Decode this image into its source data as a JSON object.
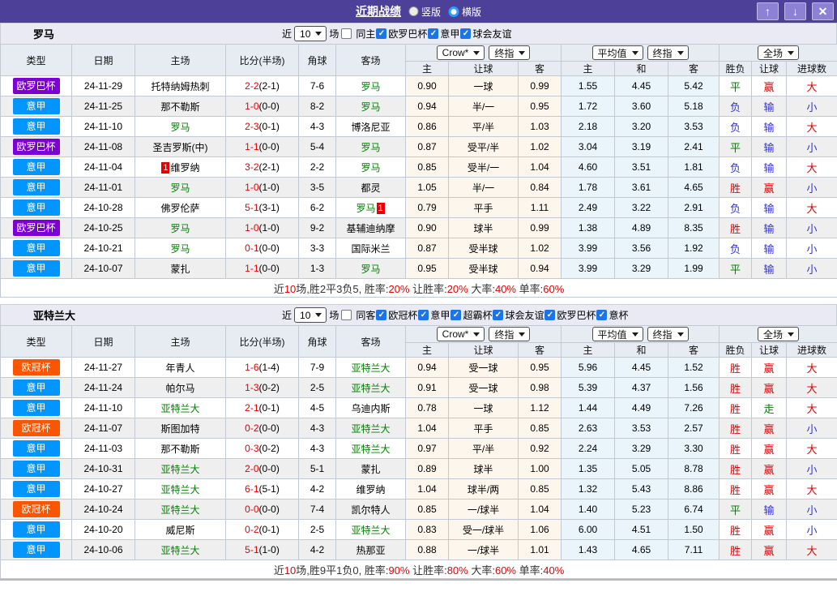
{
  "titlebar": {
    "title": "近期战绩",
    "view_options": [
      {
        "label": "竖版",
        "selected": false
      },
      {
        "label": "横版",
        "selected": true
      }
    ],
    "icons": {
      "up": "↑",
      "down": "↓",
      "close": "✕"
    }
  },
  "filter_labels": {
    "recent": "近",
    "games": "场"
  },
  "columns": [
    "类型",
    "日期",
    "主场",
    "比分(半场)",
    "角球",
    "客场"
  ],
  "sub_columns": [
    "主",
    "让球",
    "客",
    "主",
    "和",
    "客",
    "胜负",
    "让球",
    "进球数"
  ],
  "selects": {
    "odds_source": "Crow*",
    "odds_final": "终指",
    "avg": "平均值",
    "avg_final": "终指",
    "scope": "全场"
  },
  "type_colors": {
    "欧罗巴杯": "#7d00d2",
    "意甲": "#0095ff",
    "欧冠杯": "#fa5500"
  },
  "colors": {
    "header_bar": "#4c4099",
    "win_red": "#e60000",
    "draw_green": "#008000",
    "lose_blue": "#3333cc",
    "focus_team_green": "#008000",
    "odds_col_bg": "#fdf6ec",
    "avg_col_bg": "#e9f4fb",
    "checkbox_blue": "#1b74e8"
  },
  "teams": [
    {
      "name": "罗马",
      "filter": {
        "count": "10",
        "same_label": "同主",
        "same_checked": false,
        "competitions": [
          "欧罗巴杯",
          "意甲",
          "球会友谊"
        ]
      },
      "rows": [
        {
          "type": "欧罗巴杯",
          "date": "24-11-29",
          "home": {
            "name": "托特纳姆热刺"
          },
          "score": {
            "ft": "2-2",
            "ht": "(2-1)"
          },
          "corner": "7-6",
          "away": {
            "name": "罗马",
            "focus": true
          },
          "odds": [
            "0.90",
            "一球",
            "0.99"
          ],
          "avg": [
            "1.55",
            "4.45",
            "5.42"
          ],
          "results": [
            [
              "平",
              "g"
            ],
            [
              "赢",
              "r"
            ],
            [
              "大",
              "r"
            ]
          ]
        },
        {
          "type": "意甲",
          "date": "24-11-25",
          "home": {
            "name": "那不勒斯"
          },
          "score": {
            "ft": "1-0",
            "ht": "(0-0)"
          },
          "corner": "8-2",
          "away": {
            "name": "罗马",
            "focus": true
          },
          "odds": [
            "0.94",
            "半/一",
            "0.95"
          ],
          "avg": [
            "1.72",
            "3.60",
            "5.18"
          ],
          "results": [
            [
              "负",
              "b"
            ],
            [
              "输",
              "b"
            ],
            [
              "小",
              "b"
            ]
          ]
        },
        {
          "type": "意甲",
          "date": "24-11-10",
          "home": {
            "name": "罗马",
            "focus": true
          },
          "score": {
            "ft": "2-3",
            "ht": "(0-1)"
          },
          "corner": "4-3",
          "away": {
            "name": "博洛尼亚"
          },
          "odds": [
            "0.86",
            "平/半",
            "1.03"
          ],
          "avg": [
            "2.18",
            "3.20",
            "3.53"
          ],
          "results": [
            [
              "负",
              "b"
            ],
            [
              "输",
              "b"
            ],
            [
              "大",
              "r"
            ]
          ]
        },
        {
          "type": "欧罗巴杯",
          "date": "24-11-08",
          "home": {
            "name": "圣吉罗斯(中)"
          },
          "score": {
            "ft": "1-1",
            "ht": "(0-0)"
          },
          "corner": "5-4",
          "away": {
            "name": "罗马",
            "focus": true
          },
          "odds": [
            "0.87",
            "受平/半",
            "1.02"
          ],
          "avg": [
            "3.04",
            "3.19",
            "2.41"
          ],
          "results": [
            [
              "平",
              "g"
            ],
            [
              "输",
              "b"
            ],
            [
              "小",
              "b"
            ]
          ]
        },
        {
          "type": "意甲",
          "date": "24-11-04",
          "home": {
            "name": "维罗纳",
            "card": "left"
          },
          "score": {
            "ft": "3-2",
            "ht": "(2-1)"
          },
          "corner": "2-2",
          "away": {
            "name": "罗马",
            "focus": true
          },
          "odds": [
            "0.85",
            "受半/一",
            "1.04"
          ],
          "avg": [
            "4.60",
            "3.51",
            "1.81"
          ],
          "results": [
            [
              "负",
              "b"
            ],
            [
              "输",
              "b"
            ],
            [
              "大",
              "r"
            ]
          ]
        },
        {
          "type": "意甲",
          "date": "24-11-01",
          "home": {
            "name": "罗马",
            "focus": true
          },
          "score": {
            "ft": "1-0",
            "ht": "(1-0)"
          },
          "corner": "3-5",
          "away": {
            "name": "都灵"
          },
          "odds": [
            "1.05",
            "半/一",
            "0.84"
          ],
          "avg": [
            "1.78",
            "3.61",
            "4.65"
          ],
          "results": [
            [
              "胜",
              "r"
            ],
            [
              "赢",
              "r"
            ],
            [
              "小",
              "b"
            ]
          ]
        },
        {
          "type": "意甲",
          "date": "24-10-28",
          "home": {
            "name": "佛罗伦萨"
          },
          "score": {
            "ft": "5-1",
            "ht": "(3-1)"
          },
          "corner": "6-2",
          "away": {
            "name": "罗马",
            "focus": true,
            "card": "right"
          },
          "odds": [
            "0.79",
            "平手",
            "1.11"
          ],
          "avg": [
            "2.49",
            "3.22",
            "2.91"
          ],
          "results": [
            [
              "负",
              "b"
            ],
            [
              "输",
              "b"
            ],
            [
              "大",
              "r"
            ]
          ]
        },
        {
          "type": "欧罗巴杯",
          "date": "24-10-25",
          "home": {
            "name": "罗马",
            "focus": true
          },
          "score": {
            "ft": "1-0",
            "ht": "(1-0)"
          },
          "corner": "9-2",
          "away": {
            "name": "基辅迪纳摩"
          },
          "odds": [
            "0.90",
            "球半",
            "0.99"
          ],
          "avg": [
            "1.38",
            "4.89",
            "8.35"
          ],
          "results": [
            [
              "胜",
              "r"
            ],
            [
              "输",
              "b"
            ],
            [
              "小",
              "b"
            ]
          ]
        },
        {
          "type": "意甲",
          "date": "24-10-21",
          "home": {
            "name": "罗马",
            "focus": true
          },
          "score": {
            "ft": "0-1",
            "ht": "(0-0)"
          },
          "corner": "3-3",
          "away": {
            "name": "国际米兰"
          },
          "odds": [
            "0.87",
            "受半球",
            "1.02"
          ],
          "avg": [
            "3.99",
            "3.56",
            "1.92"
          ],
          "results": [
            [
              "负",
              "b"
            ],
            [
              "输",
              "b"
            ],
            [
              "小",
              "b"
            ]
          ]
        },
        {
          "type": "意甲",
          "date": "24-10-07",
          "home": {
            "name": "蒙扎"
          },
          "score": {
            "ft": "1-1",
            "ht": "(0-0)"
          },
          "corner": "1-3",
          "away": {
            "name": "罗马",
            "focus": true
          },
          "odds": [
            "0.95",
            "受半球",
            "0.94"
          ],
          "avg": [
            "3.99",
            "3.29",
            "1.99"
          ],
          "results": [
            [
              "平",
              "g"
            ],
            [
              "输",
              "b"
            ],
            [
              "小",
              "b"
            ]
          ]
        }
      ],
      "summary": [
        {
          "t": "近"
        },
        {
          "t": "10",
          "red": true
        },
        {
          "t": "场,胜2平3负5, 胜率:"
        },
        {
          "t": "20%",
          "red": true
        },
        {
          "t": " 让胜率:"
        },
        {
          "t": "20%",
          "red": true
        },
        {
          "t": " 大率:"
        },
        {
          "t": "40%",
          "red": true
        },
        {
          "t": " 单率:"
        },
        {
          "t": "60%",
          "red": true
        }
      ]
    },
    {
      "name": "亚特兰大",
      "filter": {
        "count": "10",
        "same_label": "同客",
        "same_checked": false,
        "competitions": [
          "欧冠杯",
          "意甲",
          "超霸杯",
          "球会友谊",
          "欧罗巴杯",
          "意杯"
        ]
      },
      "rows": [
        {
          "type": "欧冠杯",
          "date": "24-11-27",
          "home": {
            "name": "年青人"
          },
          "score": {
            "ft": "1-6",
            "ht": "(1-4)"
          },
          "corner": "7-9",
          "away": {
            "name": "亚特兰大",
            "focus": true
          },
          "odds": [
            "0.94",
            "受一球",
            "0.95"
          ],
          "avg": [
            "5.96",
            "4.45",
            "1.52"
          ],
          "results": [
            [
              "胜",
              "r"
            ],
            [
              "赢",
              "r"
            ],
            [
              "大",
              "r"
            ]
          ]
        },
        {
          "type": "意甲",
          "date": "24-11-24",
          "home": {
            "name": "帕尔马"
          },
          "score": {
            "ft": "1-3",
            "ht": "(0-2)"
          },
          "corner": "2-5",
          "away": {
            "name": "亚特兰大",
            "focus": true
          },
          "odds": [
            "0.91",
            "受一球",
            "0.98"
          ],
          "avg": [
            "5.39",
            "4.37",
            "1.56"
          ],
          "results": [
            [
              "胜",
              "r"
            ],
            [
              "赢",
              "r"
            ],
            [
              "大",
              "r"
            ]
          ]
        },
        {
          "type": "意甲",
          "date": "24-11-10",
          "home": {
            "name": "亚特兰大",
            "focus": true
          },
          "score": {
            "ft": "2-1",
            "ht": "(0-1)"
          },
          "corner": "4-5",
          "away": {
            "name": "乌迪内斯"
          },
          "odds": [
            "0.78",
            "一球",
            "1.12"
          ],
          "avg": [
            "1.44",
            "4.49",
            "7.26"
          ],
          "results": [
            [
              "胜",
              "r"
            ],
            [
              "走",
              "g"
            ],
            [
              "大",
              "r"
            ]
          ]
        },
        {
          "type": "欧冠杯",
          "date": "24-11-07",
          "home": {
            "name": "斯图加特"
          },
          "score": {
            "ft": "0-2",
            "ht": "(0-0)"
          },
          "corner": "4-3",
          "away": {
            "name": "亚特兰大",
            "focus": true
          },
          "odds": [
            "1.04",
            "平手",
            "0.85"
          ],
          "avg": [
            "2.63",
            "3.53",
            "2.57"
          ],
          "results": [
            [
              "胜",
              "r"
            ],
            [
              "赢",
              "r"
            ],
            [
              "小",
              "b"
            ]
          ]
        },
        {
          "type": "意甲",
          "date": "24-11-03",
          "home": {
            "name": "那不勒斯"
          },
          "score": {
            "ft": "0-3",
            "ht": "(0-2)"
          },
          "corner": "4-3",
          "away": {
            "name": "亚特兰大",
            "focus": true
          },
          "odds": [
            "0.97",
            "平/半",
            "0.92"
          ],
          "avg": [
            "2.24",
            "3.29",
            "3.30"
          ],
          "results": [
            [
              "胜",
              "r"
            ],
            [
              "赢",
              "r"
            ],
            [
              "大",
              "r"
            ]
          ]
        },
        {
          "type": "意甲",
          "date": "24-10-31",
          "home": {
            "name": "亚特兰大",
            "focus": true
          },
          "score": {
            "ft": "2-0",
            "ht": "(0-0)"
          },
          "corner": "5-1",
          "away": {
            "name": "蒙扎"
          },
          "odds": [
            "0.89",
            "球半",
            "1.00"
          ],
          "avg": [
            "1.35",
            "5.05",
            "8.78"
          ],
          "results": [
            [
              "胜",
              "r"
            ],
            [
              "赢",
              "r"
            ],
            [
              "小",
              "b"
            ]
          ]
        },
        {
          "type": "意甲",
          "date": "24-10-27",
          "home": {
            "name": "亚特兰大",
            "focus": true
          },
          "score": {
            "ft": "6-1",
            "ht": "(5-1)"
          },
          "corner": "4-2",
          "away": {
            "name": "维罗纳"
          },
          "odds": [
            "1.04",
            "球半/两",
            "0.85"
          ],
          "avg": [
            "1.32",
            "5.43",
            "8.86"
          ],
          "results": [
            [
              "胜",
              "r"
            ],
            [
              "赢",
              "r"
            ],
            [
              "大",
              "r"
            ]
          ]
        },
        {
          "type": "欧冠杯",
          "date": "24-10-24",
          "home": {
            "name": "亚特兰大",
            "focus": true
          },
          "score": {
            "ft": "0-0",
            "ht": "(0-0)"
          },
          "corner": "7-4",
          "away": {
            "name": "凯尔特人"
          },
          "odds": [
            "0.85",
            "一/球半",
            "1.04"
          ],
          "avg": [
            "1.40",
            "5.23",
            "6.74"
          ],
          "results": [
            [
              "平",
              "g"
            ],
            [
              "输",
              "b"
            ],
            [
              "小",
              "b"
            ]
          ]
        },
        {
          "type": "意甲",
          "date": "24-10-20",
          "home": {
            "name": "威尼斯"
          },
          "score": {
            "ft": "0-2",
            "ht": "(0-1)"
          },
          "corner": "2-5",
          "away": {
            "name": "亚特兰大",
            "focus": true
          },
          "odds": [
            "0.83",
            "受一/球半",
            "1.06"
          ],
          "avg": [
            "6.00",
            "4.51",
            "1.50"
          ],
          "results": [
            [
              "胜",
              "r"
            ],
            [
              "赢",
              "r"
            ],
            [
              "小",
              "b"
            ]
          ]
        },
        {
          "type": "意甲",
          "date": "24-10-06",
          "home": {
            "name": "亚特兰大",
            "focus": true
          },
          "score": {
            "ft": "5-1",
            "ht": "(1-0)"
          },
          "corner": "4-2",
          "away": {
            "name": "热那亚"
          },
          "odds": [
            "0.88",
            "一/球半",
            "1.01"
          ],
          "avg": [
            "1.43",
            "4.65",
            "7.11"
          ],
          "results": [
            [
              "胜",
              "r"
            ],
            [
              "赢",
              "r"
            ],
            [
              "大",
              "r"
            ]
          ]
        }
      ],
      "summary": [
        {
          "t": "近"
        },
        {
          "t": "10",
          "red": true
        },
        {
          "t": "场,胜9平1负0, 胜率:"
        },
        {
          "t": "90%",
          "red": true
        },
        {
          "t": " 让胜率:"
        },
        {
          "t": "80%",
          "red": true
        },
        {
          "t": " 大率:"
        },
        {
          "t": "60%",
          "red": true
        },
        {
          "t": " 单率:"
        },
        {
          "t": "40%",
          "red": true
        }
      ]
    }
  ]
}
